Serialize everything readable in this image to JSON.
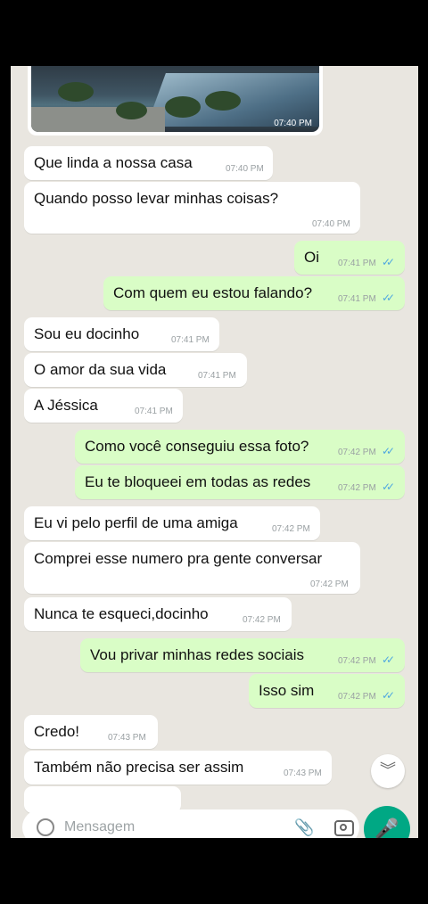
{
  "photo": {
    "time": "07:40 PM"
  },
  "messages": [
    {
      "dir": "in",
      "text": "Que linda a nossa casa",
      "time": "07:40 PM"
    },
    {
      "dir": "in",
      "text": "Quando posso levar minhas coisas?",
      "time": "07:40 PM"
    },
    {
      "dir": "out",
      "text": "Oi",
      "time": "07:41 PM"
    },
    {
      "dir": "out",
      "text": "Com quem eu estou falando?",
      "time": "07:41 PM"
    },
    {
      "dir": "in",
      "text": "Sou eu docinho",
      "time": "07:41 PM"
    },
    {
      "dir": "in",
      "text": "O amor da sua vida",
      "time": "07:41 PM"
    },
    {
      "dir": "in",
      "text": "A Jéssica",
      "time": "07:41 PM"
    },
    {
      "dir": "out",
      "text": "Como você conseguiu essa foto?",
      "time": "07:42 PM"
    },
    {
      "dir": "out",
      "text": "Eu te bloqueei em todas as redes",
      "time": "07:42 PM"
    },
    {
      "dir": "in",
      "text": "Eu vi pelo perfil de uma amiga",
      "time": "07:42 PM"
    },
    {
      "dir": "in",
      "text": "Comprei esse numero pra gente conversar",
      "time": "07:42 PM"
    },
    {
      "dir": "in",
      "text": "Nunca te esqueci,docinho",
      "time": "07:42 PM"
    },
    {
      "dir": "out",
      "text": "Vou privar minhas redes sociais",
      "time": "07:42 PM"
    },
    {
      "dir": "out",
      "text": "Isso sim",
      "time": "07:42 PM"
    },
    {
      "dir": "in",
      "text": "Credo!",
      "time": "07:43 PM"
    },
    {
      "dir": "in",
      "text": "Também não precisa ser assim",
      "time": "07:43 PM"
    }
  ],
  "composer": {
    "placeholder": "Mensagem"
  },
  "icons": {
    "scroll_down": "double-chevron-down-icon",
    "emoji": "emoji-icon",
    "attach": "paperclip-icon",
    "camera": "camera-icon",
    "mic": "microphone-icon",
    "read_receipt": "double-check-icon"
  },
  "colors": {
    "incoming": "#ffffff",
    "outgoing": "#d9fdc6",
    "wallpaper": "#e9e6e0",
    "accent": "#00a884",
    "ticks": "#4fa8e0"
  }
}
